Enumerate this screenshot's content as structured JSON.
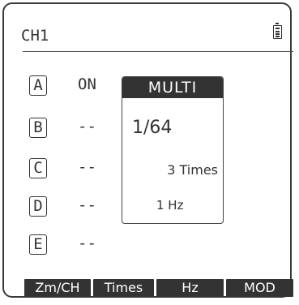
{
  "header": {
    "channel_title": "CH1",
    "battery_icon": "battery-icon"
  },
  "channels": [
    {
      "letter": "A",
      "state": "ON"
    },
    {
      "letter": "B",
      "state": "--"
    },
    {
      "letter": "C",
      "state": "--"
    },
    {
      "letter": "D",
      "state": "--"
    },
    {
      "letter": "E",
      "state": "--"
    }
  ],
  "multi": {
    "title": "MULTI",
    "ratio": "1/64",
    "times": "3 Times",
    "frequency": "1 Hz"
  },
  "softkeys": [
    "Zm/CH",
    "Times",
    "Hz",
    "MOD"
  ],
  "colors": {
    "foreground": "#333333",
    "background": "#ffffff"
  }
}
